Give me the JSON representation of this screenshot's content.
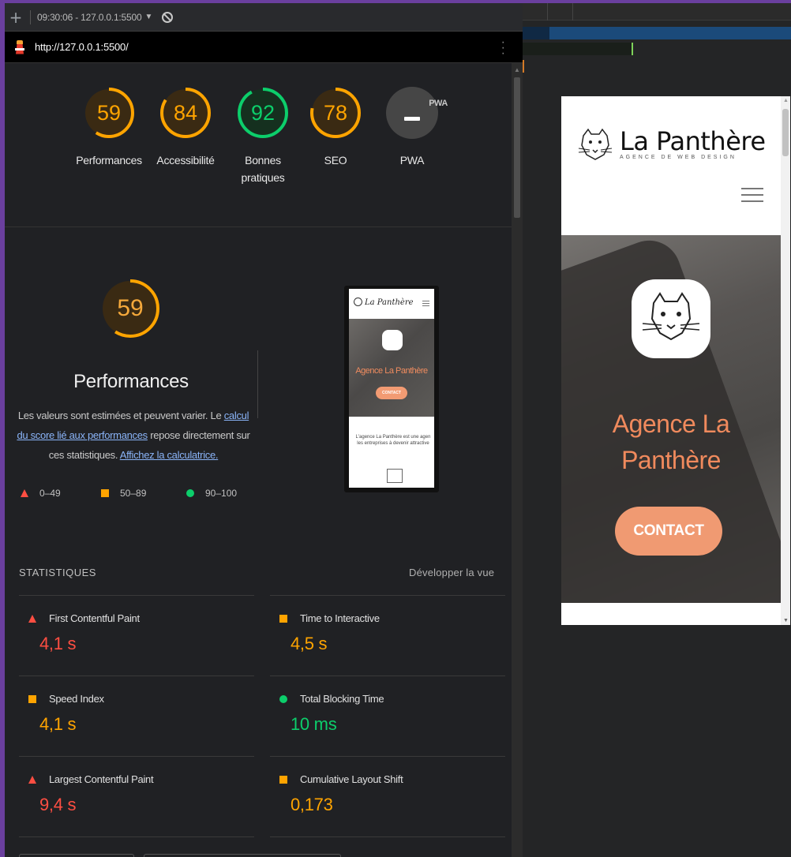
{
  "toolbar": {
    "plus": "+",
    "session": "09:30:06 - 127.0.0.1:5500",
    "caret": "▼"
  },
  "urlbar": {
    "url": "http://127.0.0.1:5500/"
  },
  "gauges": [
    {
      "score": "59",
      "label": "Performances",
      "value": 59,
      "color": "#ffa400"
    },
    {
      "score": "84",
      "label": "Accessibilité",
      "value": 84,
      "color": "#ffa400"
    },
    {
      "score": "92",
      "label": "Bonnes pratiques",
      "value": 92,
      "color": "#0cce6b"
    },
    {
      "score": "78",
      "label": "SEO",
      "value": 78,
      "color": "#ffa400"
    }
  ],
  "pwa": {
    "badge": "PWA",
    "label": "PWA"
  },
  "performance": {
    "score": "59",
    "value": 59,
    "title": "Performances",
    "desc_1": "Les valeurs sont estimées et peuvent varier. Le ",
    "link_1": "calcul du score lié aux performances",
    "desc_2": " repose directement sur ces statistiques. ",
    "link_2": "Affichez la calculatrice."
  },
  "legend": {
    "fail": "0–49",
    "average": "50–89",
    "pass": "90–100"
  },
  "thumbnail": {
    "logo": "La Panthère",
    "hero_title": "Agence La Panthère",
    "button": "CONTACT",
    "text_1": "L'agence La Panthère est une agen",
    "text_2": "les entreprises à devenir attractive"
  },
  "stats": {
    "heading": "STATISTIQUES",
    "expand": "Développer la vue",
    "metrics": [
      {
        "name": "First Contentful Paint",
        "value": "4,1 s"
      },
      {
        "name": "Time to Interactive",
        "value": "4,5 s"
      },
      {
        "name": "Speed Index",
        "value": "4,1 s"
      },
      {
        "name": "Total Blocking Time",
        "value": "10 ms"
      },
      {
        "name": "Largest Contentful Paint",
        "value": "9,4 s"
      },
      {
        "name": "Cumulative Layout Shift",
        "value": "0,173"
      }
    ]
  },
  "preview": {
    "logo": "La Panthère",
    "subtitle": "AGENCE DE WEB DESIGN",
    "hero_title_1": "Agence La",
    "hero_title_2": "Panthère",
    "button": "CONTACT"
  },
  "colors": {
    "fail": "#ff4e42",
    "average": "#ffa400",
    "pass": "#0cce6b",
    "accent": "#f09a72"
  }
}
